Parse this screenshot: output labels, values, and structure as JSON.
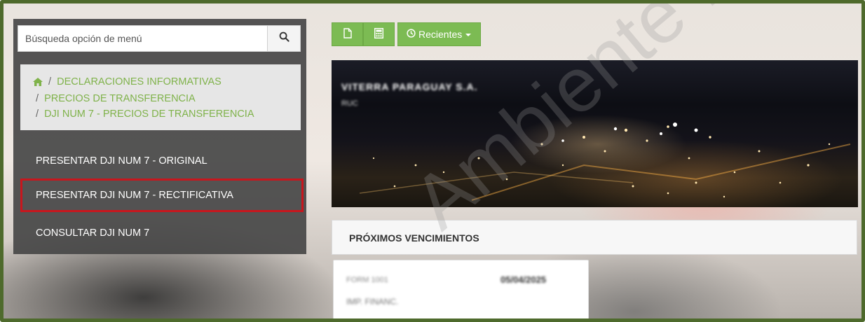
{
  "search": {
    "placeholder": "Búsqueda opción de menú",
    "value": ""
  },
  "breadcrumb": {
    "items": [
      "DECLARACIONES INFORMATIVAS",
      "PRECIOS DE TRANSFERENCIA",
      "DJI NUM 7 - PRECIOS DE TRANSFERENCIA"
    ],
    "separator": "/"
  },
  "menu": {
    "items": [
      {
        "label": "PRESENTAR DJI NUM 7 - ORIGINAL",
        "selected": false
      },
      {
        "label": "PRESENTAR DJI NUM 7 - RECTIFICATIVA",
        "selected": true
      },
      {
        "label": "CONSULTAR DJI NUM 7",
        "selected": false
      }
    ]
  },
  "toolbar": {
    "recent_label": "Recientes"
  },
  "banner": {
    "company": "VITERRA PARAGUAY S.A.",
    "subtitle": "RUC"
  },
  "next_due": {
    "title": "PRÓXIMOS VENCIMIENTOS",
    "card": {
      "label": "FORM 1001",
      "date": "05/04/2025",
      "sub": "IMP. FINANC."
    }
  },
  "watermark": "Ambiente Prueba",
  "colors": {
    "accent_green": "#7cbb53",
    "selection_red": "#c8161d",
    "frame_green": "#4e6a2c"
  }
}
